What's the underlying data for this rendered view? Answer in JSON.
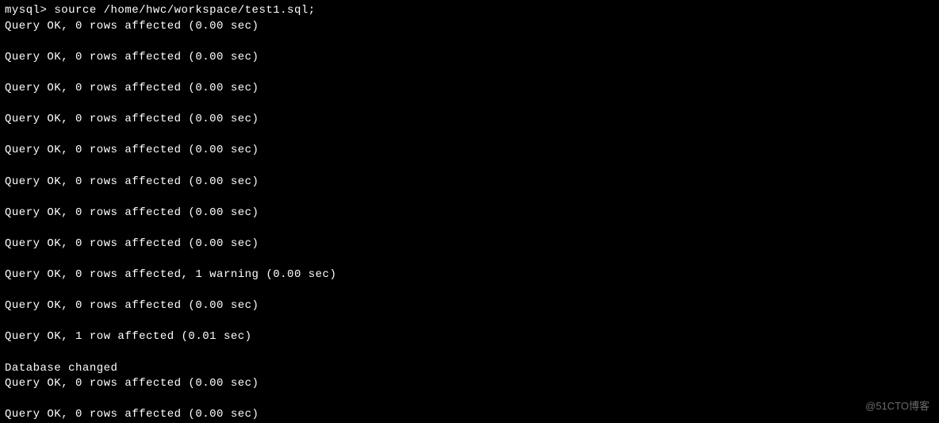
{
  "prompt": {
    "prefix": "mysql> ",
    "command": "source /home/hwc/workspace/test1.sql;"
  },
  "lines": [
    {
      "type": "text",
      "value": "Query OK, 0 rows affected (0.00 sec)"
    },
    {
      "type": "blank"
    },
    {
      "type": "text",
      "value": "Query OK, 0 rows affected (0.00 sec)"
    },
    {
      "type": "blank"
    },
    {
      "type": "text",
      "value": "Query OK, 0 rows affected (0.00 sec)"
    },
    {
      "type": "blank"
    },
    {
      "type": "text",
      "value": "Query OK, 0 rows affected (0.00 sec)"
    },
    {
      "type": "blank"
    },
    {
      "type": "text",
      "value": "Query OK, 0 rows affected (0.00 sec)"
    },
    {
      "type": "blank"
    },
    {
      "type": "text",
      "value": "Query OK, 0 rows affected (0.00 sec)"
    },
    {
      "type": "blank"
    },
    {
      "type": "text",
      "value": "Query OK, 0 rows affected (0.00 sec)"
    },
    {
      "type": "blank"
    },
    {
      "type": "text",
      "value": "Query OK, 0 rows affected (0.00 sec)"
    },
    {
      "type": "blank"
    },
    {
      "type": "text",
      "value": "Query OK, 0 rows affected, 1 warning (0.00 sec)"
    },
    {
      "type": "blank"
    },
    {
      "type": "text",
      "value": "Query OK, 0 rows affected (0.00 sec)"
    },
    {
      "type": "blank"
    },
    {
      "type": "text",
      "value": "Query OK, 1 row affected (0.01 sec)"
    },
    {
      "type": "blank"
    },
    {
      "type": "text",
      "value": "Database changed"
    },
    {
      "type": "text",
      "value": "Query OK, 0 rows affected (0.00 sec)"
    },
    {
      "type": "blank"
    },
    {
      "type": "text",
      "value": "Query OK, 0 rows affected (0.00 sec)"
    }
  ],
  "watermark": "@51CTO博客"
}
